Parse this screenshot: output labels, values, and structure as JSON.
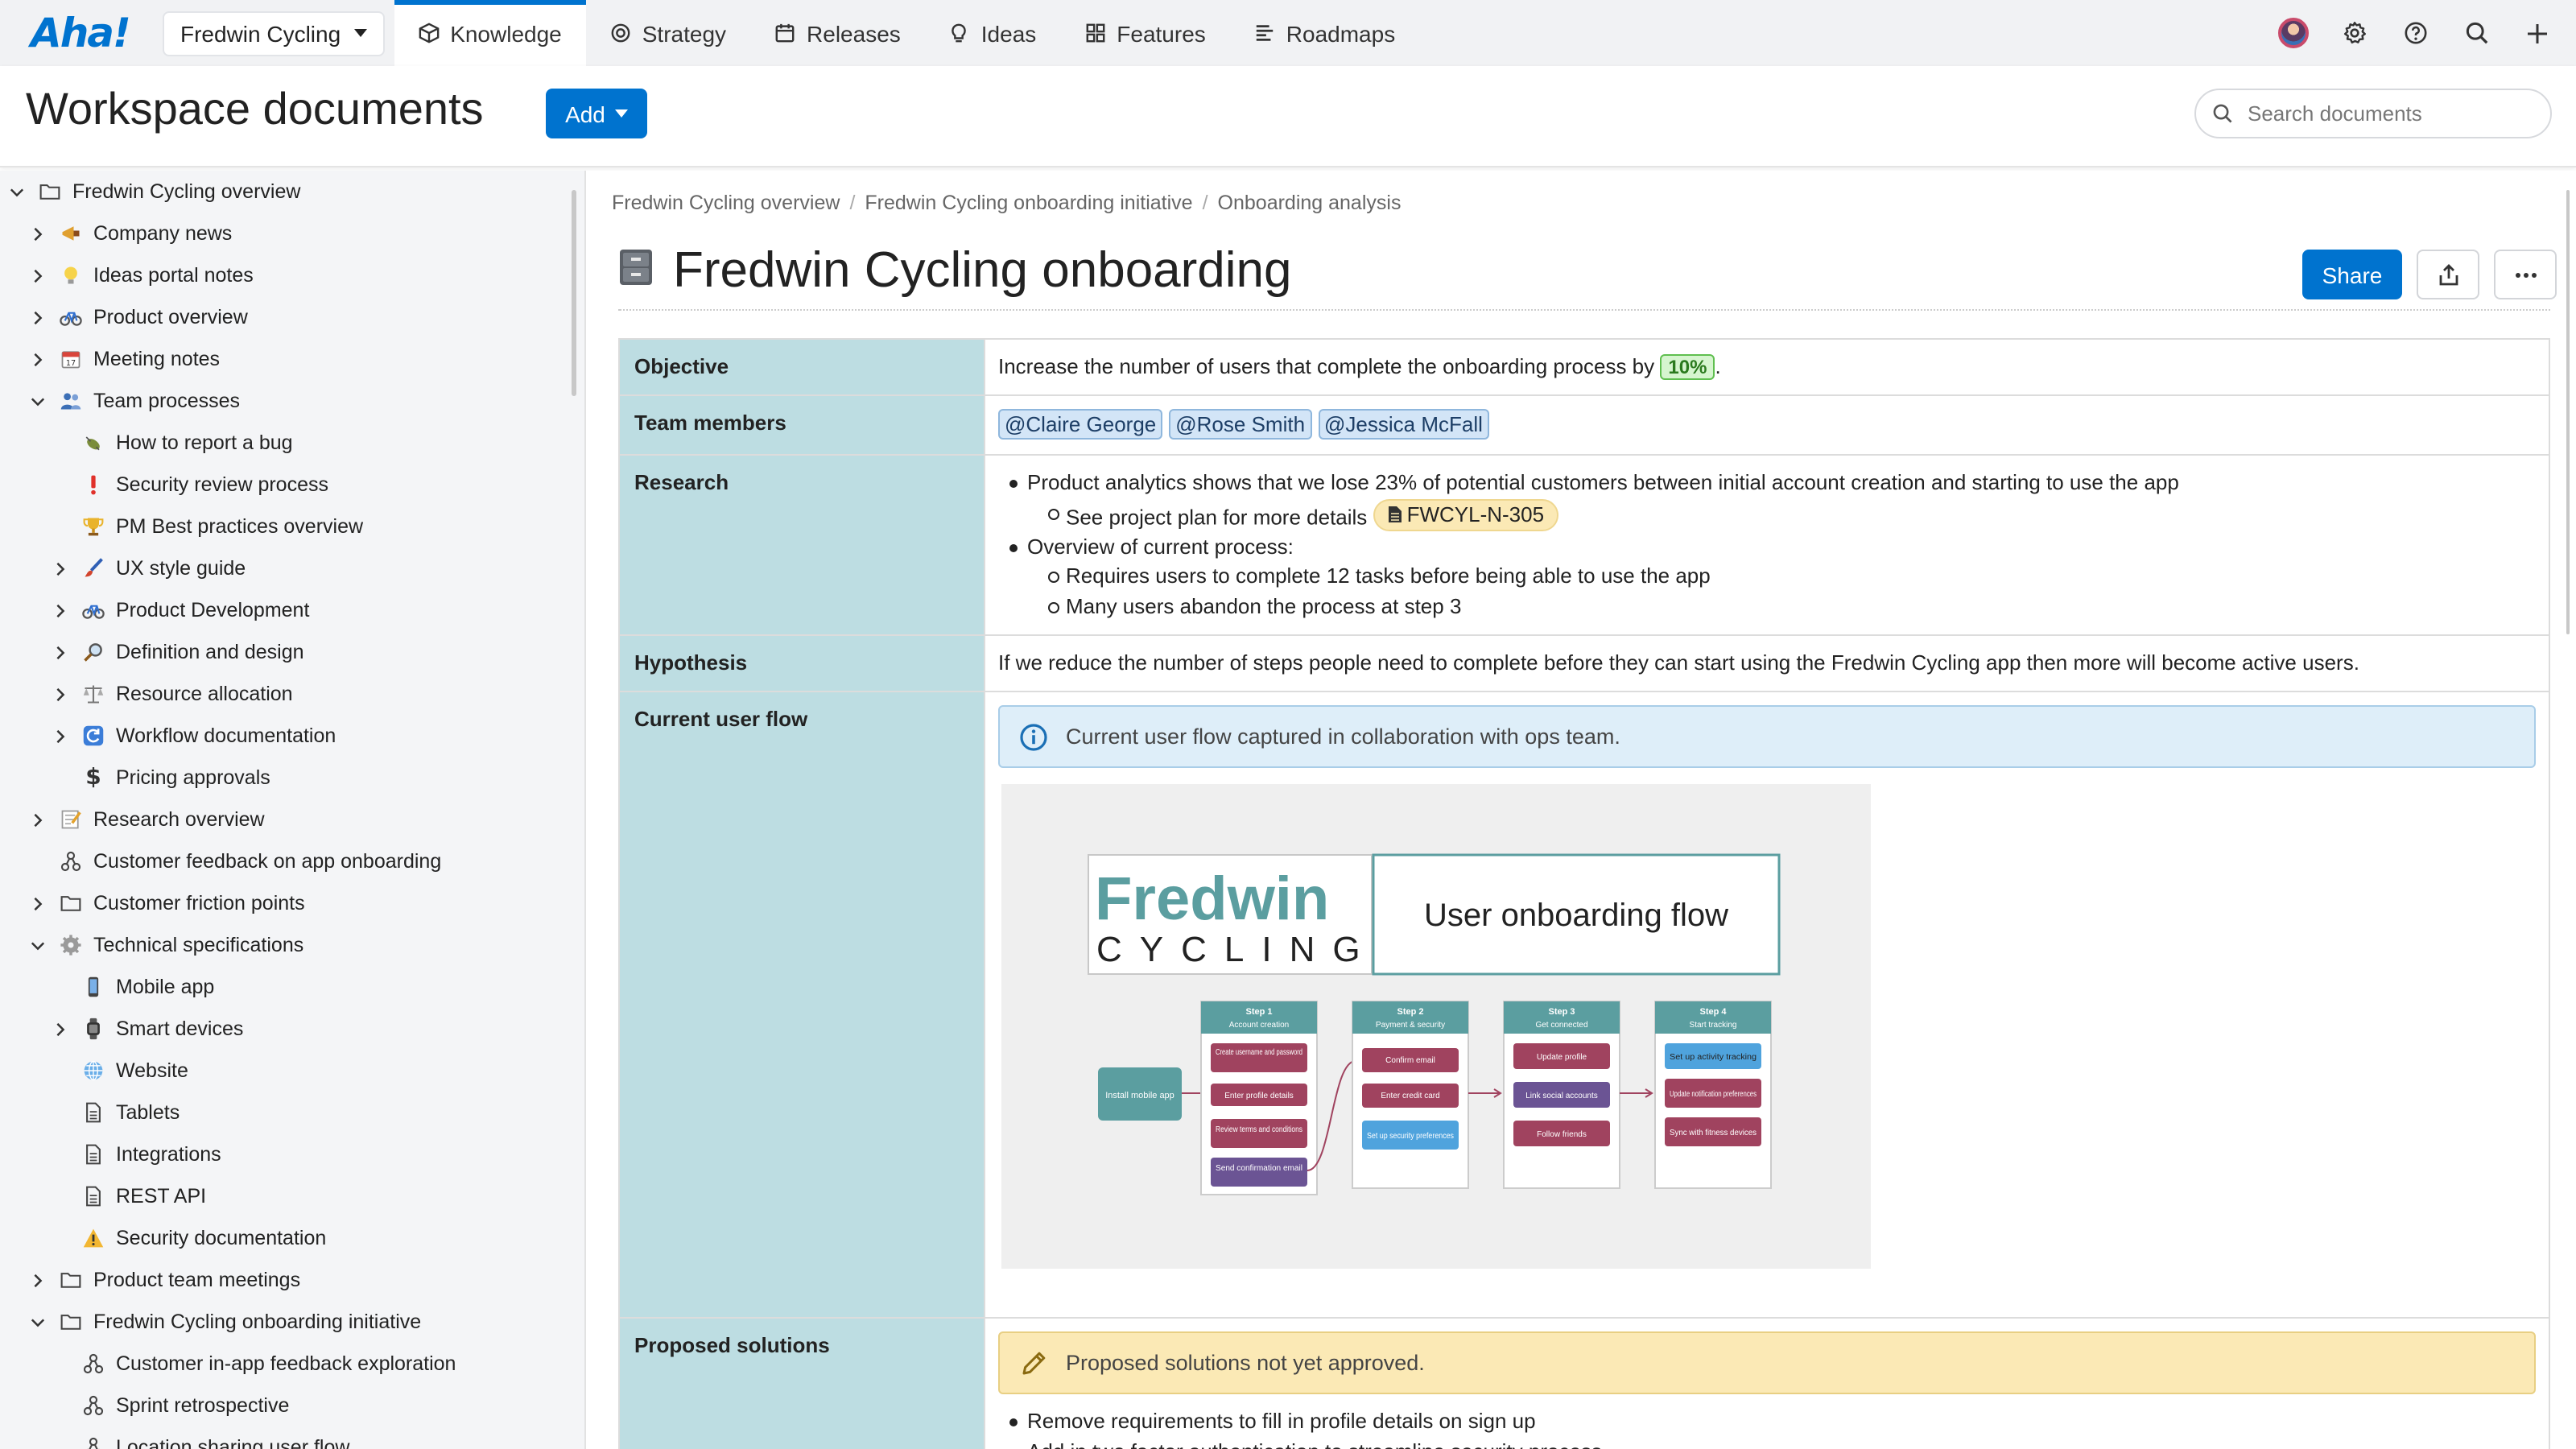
{
  "app": {
    "logo": "Aha!",
    "workspace": "Fredwin Cycling"
  },
  "nav": {
    "tabs": [
      {
        "label": "Knowledge",
        "icon": "knowledge-icon"
      },
      {
        "label": "Strategy",
        "icon": "strategy-icon"
      },
      {
        "label": "Releases",
        "icon": "releases-icon"
      },
      {
        "label": "Ideas",
        "icon": "ideas-icon"
      },
      {
        "label": "Features",
        "icon": "features-icon"
      },
      {
        "label": "Roadmaps",
        "icon": "roadmaps-icon"
      }
    ],
    "active_tab": "Knowledge"
  },
  "header": {
    "title": "Workspace documents",
    "add_label": "Add",
    "search_placeholder": "Search documents"
  },
  "sidebar": {
    "items": [
      {
        "label": "Fredwin Cycling overview",
        "icon": "folder-icon",
        "expanded": true
      },
      {
        "label": "Company news",
        "icon": "megaphone-icon"
      },
      {
        "label": "Ideas portal notes",
        "icon": "lightbulb-icon"
      },
      {
        "label": "Product overview",
        "icon": "bicycle-icon"
      },
      {
        "label": "Meeting notes",
        "icon": "calendar-icon"
      },
      {
        "label": "Team processes",
        "icon": "people-icon",
        "expanded": true
      },
      {
        "label": "How to report a bug",
        "icon": "bug-icon"
      },
      {
        "label": "Security review process",
        "icon": "exclamation-icon"
      },
      {
        "label": "PM Best practices overview",
        "icon": "trophy-icon"
      },
      {
        "label": "UX style guide",
        "icon": "paintbrush-icon"
      },
      {
        "label": "Product Development",
        "icon": "bicycle-icon"
      },
      {
        "label": "Definition and design",
        "icon": "magnifier-icon"
      },
      {
        "label": "Resource allocation",
        "icon": "scales-icon"
      },
      {
        "label": "Workflow documentation",
        "icon": "refresh-icon"
      },
      {
        "label": "Pricing approvals",
        "icon": "dollar-icon"
      },
      {
        "label": "Research overview",
        "icon": "memo-icon"
      },
      {
        "label": "Customer feedback on app onboarding",
        "icon": "whiteboard-icon"
      },
      {
        "label": "Customer friction points",
        "icon": "folder-icon"
      },
      {
        "label": "Technical specifications",
        "icon": "gear-icon",
        "expanded": true
      },
      {
        "label": "Mobile app",
        "icon": "phone-icon"
      },
      {
        "label": "Smart devices",
        "icon": "watch-icon"
      },
      {
        "label": "Website",
        "icon": "globe-icon"
      },
      {
        "label": "Tablets",
        "icon": "document-icon"
      },
      {
        "label": "Integrations",
        "icon": "document-icon"
      },
      {
        "label": "REST API",
        "icon": "document-icon"
      },
      {
        "label": "Security documentation",
        "icon": "warning-icon"
      },
      {
        "label": "Product team meetings",
        "icon": "folder-icon"
      },
      {
        "label": "Fredwin Cycling onboarding initiative",
        "icon": "folder-icon",
        "expanded": true
      },
      {
        "label": "Customer in-app feedback exploration",
        "icon": "whiteboard-icon"
      },
      {
        "label": "Sprint retrospective",
        "icon": "whiteboard-icon"
      },
      {
        "label": "Location sharing user flow",
        "icon": "whiteboard-icon"
      }
    ]
  },
  "breadcrumb": [
    "Fredwin Cycling overview",
    "Fredwin Cycling onboarding initiative",
    "Onboarding analysis"
  ],
  "document": {
    "title": "Fredwin Cycling onboarding",
    "share_label": "Share",
    "rows": {
      "objective": {
        "label": "Objective",
        "text": "Increase the number of users that complete the onboarding process by",
        "percent": "10%",
        "suffix": "."
      },
      "team": {
        "label": "Team members",
        "members": [
          "@Claire George",
          "@Rose Smith",
          "@Jessica McFall"
        ]
      },
      "research": {
        "label": "Research",
        "b1": "Product analytics shows that we lose 23% of potential customers between initial account creation and starting to use the app",
        "b1_sub": "See project plan for more details",
        "record": "FWCYL-N-305",
        "b2": "Overview of current process:",
        "b2_sub1": "Requires users to complete 12 tasks before being able to use the app",
        "b2_sub2": "Many users abandon the process at step 3"
      },
      "hypothesis": {
        "label": "Hypothesis",
        "text": "If we reduce the number of steps people need to complete before they can start using the Fredwin Cycling app then more will become active users."
      },
      "flow": {
        "label": "Current user flow",
        "callout": "Current user flow captured in collaboration with ops team.",
        "image": {
          "brand_top": "Fredwin",
          "brand_bottom": "CYCLING",
          "heading": "User onboarding flow",
          "start": "Install mobile app",
          "steps": [
            {
              "title": "Step 1",
              "subtitle": "Account creation",
              "tasks": [
                "Create username and password",
                "Enter profile details",
                "Review terms and conditions",
                "Send confirmation email"
              ]
            },
            {
              "title": "Step 2",
              "subtitle": "Payment & security",
              "tasks": [
                "Confirm email",
                "Enter credit card",
                "Set up security preferences"
              ]
            },
            {
              "title": "Step 3",
              "subtitle": "Get connected",
              "tasks": [
                "Update profile",
                "Link social accounts",
                "Follow friends"
              ]
            },
            {
              "title": "Step 4",
              "subtitle": "Start tracking",
              "tasks": [
                "Set up activity tracking",
                "Update notification preferences",
                "Sync with fitness devices"
              ]
            }
          ]
        }
      },
      "proposed": {
        "label": "Proposed solutions",
        "callout": "Proposed solutions not yet approved.",
        "items": [
          "Remove requirements to fill in profile details on sign up",
          "Add in two factor authentication to streamline security process"
        ]
      }
    }
  },
  "colors": {
    "accent": "#0073cf",
    "label_cell": "#bddde2",
    "teal": "#5b9ea0",
    "task_red": "#a0435f",
    "task_purple": "#6b5494",
    "task_blue": "#4fa3dd"
  }
}
